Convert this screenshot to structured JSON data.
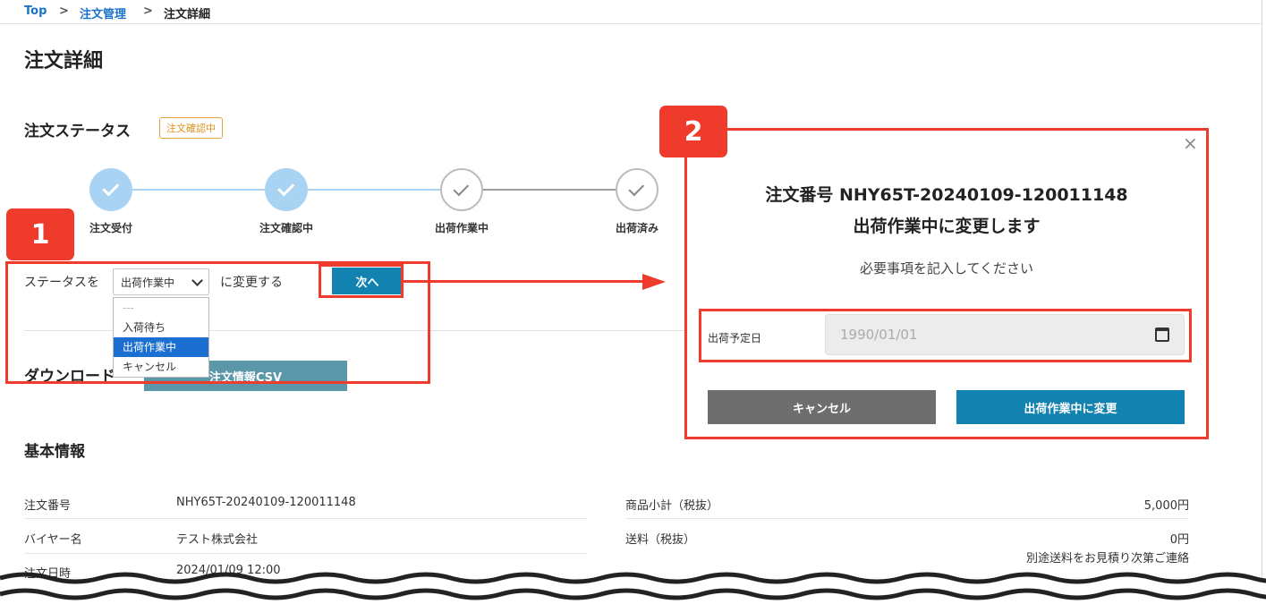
{
  "breadcrumb": {
    "top": "Top",
    "orders": "注文管理",
    "current": "注文詳細",
    "sep": ">"
  },
  "page": {
    "title": "注文詳細"
  },
  "status_section": {
    "title": "注文ステータス",
    "badge": "注文確認中",
    "steps": [
      {
        "label": "注文受付",
        "state": "done"
      },
      {
        "label": "注文確認中",
        "state": "done"
      },
      {
        "label": "出荷作業中",
        "state": "todo"
      },
      {
        "label": "出荷済み",
        "state": "todo"
      }
    ]
  },
  "status_change": {
    "prefix": "ステータスを",
    "selected": "出荷作業中",
    "suffix": "に変更する",
    "next_label": "次へ",
    "options": [
      "---",
      "入荷待ち",
      "出荷作業中",
      "キャンセル"
    ],
    "selected_index": 2
  },
  "download": {
    "title": "ダウンロード",
    "csv_label": "注文情報CSV"
  },
  "callouts": {
    "one": "1",
    "two": "2"
  },
  "modal": {
    "close": "×",
    "heading_line1": "注文番号 NHY65T-20240109-120011148",
    "heading_line2": "出荷作業中に変更します",
    "subtext": "必要事項を記入してください",
    "field_label": "出荷予定日",
    "date_placeholder": "1990/01/01",
    "cancel_label": "キャンセル",
    "confirm_label": "出荷作業中に変更"
  },
  "basic_info": {
    "title": "基本情報",
    "left": [
      {
        "label": "注文番号",
        "value": "NHY65T-20240109-120011148"
      },
      {
        "label": "バイヤー名",
        "value": "テスト株式会社"
      },
      {
        "label": "注文日時",
        "value": "2024/01/09 12:00"
      }
    ],
    "right": [
      {
        "label": "商品小計（税抜）",
        "value": "5,000円"
      },
      {
        "label": "送料（税抜）",
        "value": "0円",
        "note": "別途送料をお見積り次第ご連絡"
      }
    ]
  },
  "colors": {
    "accent": "#1282b0",
    "highlight": "#ef3b2c",
    "badge": "#e0901a",
    "step_done": "#a9d3f2"
  }
}
